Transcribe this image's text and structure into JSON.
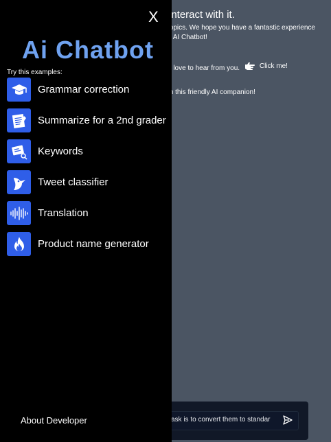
{
  "background": {
    "heading": "interact with it.",
    "line1": "topics. We hope you have a fantastic experience",
    "line2": "e AI Chatbot!",
    "line3": "d love to hear from you.",
    "click_me": "Click me!",
    "line4": "th this friendly AI companion!",
    "input_value": "ask is to convert them to standar"
  },
  "drawer": {
    "close_label": "X",
    "title": "Ai Chatbot",
    "examples_label": "Try this examples:",
    "examples": [
      {
        "label": "Grammar correction",
        "icon": "graduation-cap-icon"
      },
      {
        "label": "Summarize for a 2nd grader",
        "icon": "notepad-icon"
      },
      {
        "label": "Keywords",
        "icon": "id-card-key-icon"
      },
      {
        "label": "Tweet classifier",
        "icon": "bird-icon"
      },
      {
        "label": "Translation",
        "icon": "soundwave-icon"
      },
      {
        "label": "Product name generator",
        "icon": "flame-icon"
      }
    ],
    "about_label": "About Developer"
  },
  "colors": {
    "accent": "#2f5ee8",
    "title": "#6fa2f0",
    "page_bg": "#4b5563",
    "drawer_bg": "#000000"
  }
}
